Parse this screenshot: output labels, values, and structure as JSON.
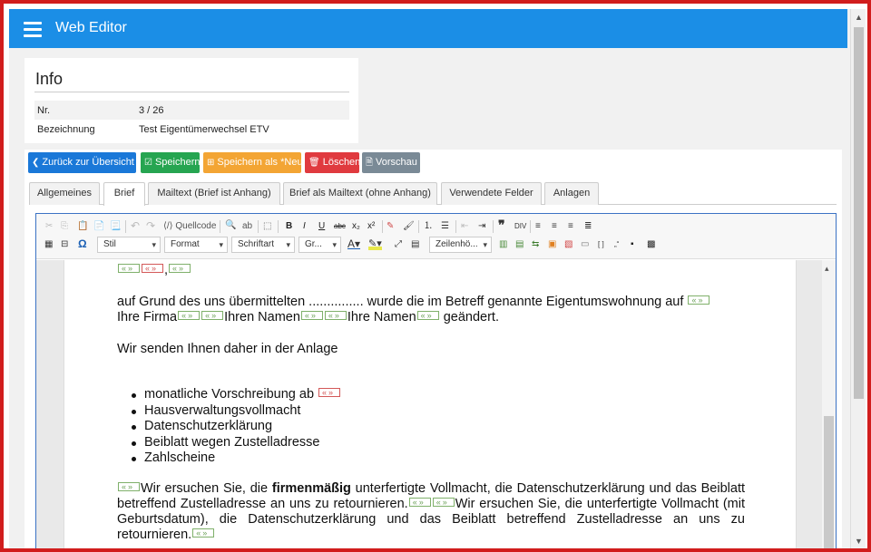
{
  "app": {
    "title": "Web Editor"
  },
  "info": {
    "title": "Info",
    "rows": [
      {
        "label": "Nr.",
        "value": "3 / 26"
      },
      {
        "label": "Bezeichnung",
        "value": "Test Eigentümerwechsel ETV"
      }
    ]
  },
  "actions": {
    "back": "Zurück zur Übersicht",
    "save": "Speichern",
    "save_as": "Speichern als *Neu",
    "delete": "Löschen",
    "preview": "Vorschau"
  },
  "tabs": [
    "Allgemeines",
    "Brief",
    "Mailtext (Brief ist Anhang)",
    "Brief als Mailtext (ohne Anhang)",
    "Verwendete Felder",
    "Anlagen"
  ],
  "active_tab": "Brief",
  "toolbar": {
    "source": "Quellcode",
    "style": "Stil",
    "format": "Format",
    "font": "Schriftart",
    "size": "Gr...",
    "lineheight": "Zeilenhö..."
  },
  "doc": {
    "p1": "auf Grund des uns übermittelten ............... wurde die im Betreff genannte Eigentumswohnung auf",
    "p1b_a": "Ihre Firma",
    "p1b_b": "Ihren Namen",
    "p1b_c": "Ihre Namen",
    "p1b_d": " geändert.",
    "p2": "Wir senden Ihnen daher in der Anlage",
    "bullets": [
      "monatliche Vorschreibung ab",
      "Hausverwaltungsvollmacht",
      "Datenschutzerklärung",
      "Beiblatt wegen Zustelladresse",
      "Zahlscheine"
    ],
    "p3a": "Wir ersuchen Sie, die ",
    "p3bold": "firmenmäßig",
    "p3b": " unterfertigte Vollmacht, die Datenschutzerklärung und das Beiblatt betreffend Zustelladresse an uns zu retournieren.",
    "p3c": "Wir ersuchen Sie, die unterfertigte Vollmacht (mit Geburtsdatum), die Datenschutzerklärung und das Beiblatt betreffend Zustelladresse an uns zu retournieren."
  },
  "colors": {
    "topbar": "#1b8ee6",
    "frame": "#d11d1d",
    "back": "#1a78d8",
    "save": "#26a551",
    "save_as": "#f3a534",
    "delete": "#e03a3f",
    "preview": "#7a8a96"
  }
}
